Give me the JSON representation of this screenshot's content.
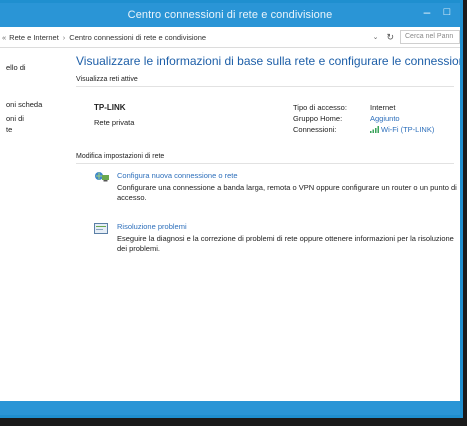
{
  "window": {
    "title": "Centro connessioni di rete e condivisione",
    "minimize_glyph": "–",
    "maximize_glyph": "□"
  },
  "addressbar": {
    "crumbs": [
      "Rete e Internet",
      "Centro connessioni di rete e condivisione"
    ],
    "prefix_glyph": "«",
    "sep_glyph": "›",
    "dropdown_glyph": "⌄",
    "refresh_glyph": "↻",
    "search_placeholder": "Cerca nel Pann"
  },
  "sidebar": {
    "items": [
      "ello di",
      "oni scheda",
      "oni di",
      "te"
    ]
  },
  "main": {
    "heading": "Visualizzare le informazioni di base sulla rete e configurare le connessioni",
    "active_networks_label": "Visualizza reti attive",
    "network": {
      "name": "TP-LINK",
      "type": "Rete privata",
      "access_type_label": "Tipo di accesso:",
      "access_type_value": "Internet",
      "homegroup_label": "Gruppo Home:",
      "homegroup_value": "Aggiunto",
      "connections_label": "Connessioni:",
      "connections_value": "Wi-Fi (TP-LINK)"
    },
    "change_settings_label": "Modifica impostazioni di rete",
    "tasks": [
      {
        "title": "Configura nuova connessione o rete",
        "description": "Configurare una connessione a banda larga, remota o VPN oppure configurare un router o un punto di accesso.",
        "icon": "network-setup-icon"
      },
      {
        "title": "Risoluzione problemi",
        "description": "Eseguire la diagnosi e la correzione di problemi di rete oppure ottenere informazioni per la risoluzione dei problemi.",
        "icon": "troubleshoot-icon"
      }
    ]
  },
  "colors": {
    "accent": "#2a95d6",
    "link": "#2d6fbb",
    "heading": "#1e5fa8"
  }
}
